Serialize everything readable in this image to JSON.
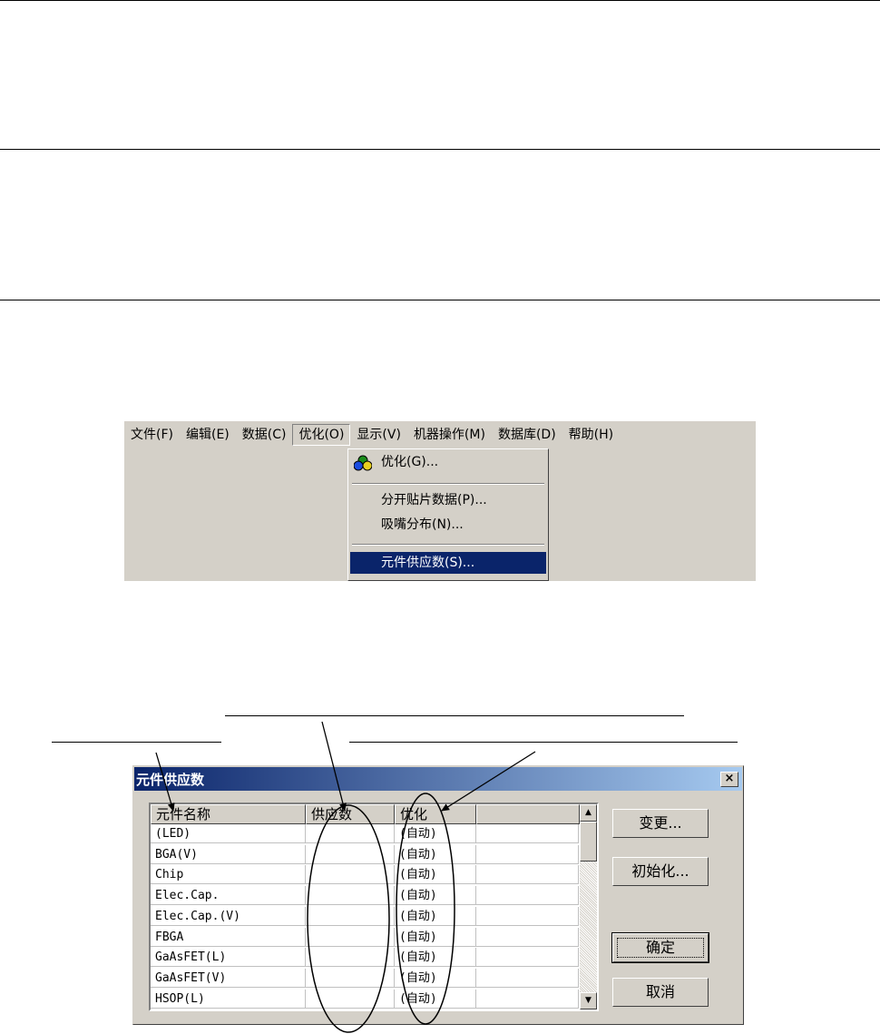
{
  "menu": {
    "items": [
      {
        "label": "文件(F)"
      },
      {
        "label": "编辑(E)"
      },
      {
        "label": "数据(C)"
      },
      {
        "label": "优化(O)",
        "open": true
      },
      {
        "label": "显示(V)"
      },
      {
        "label": "机器操作(M)"
      },
      {
        "label": "数据库(D)"
      },
      {
        "label": "帮助(H)"
      }
    ],
    "dropdown": [
      {
        "label": "优化(G)...",
        "icon": "optimize-icon"
      },
      {
        "label": "分开贴片数据(P)..."
      },
      {
        "label": "吸嘴分布(N)..."
      },
      {
        "label": "元件供应数(S)...",
        "highlighted": true
      }
    ]
  },
  "dialog": {
    "title": "元件供应数",
    "close_glyph": "×",
    "columns": [
      "元件名称",
      "供应数",
      "优化",
      ""
    ],
    "rows": [
      {
        "name": "(LED)",
        "supply": "",
        "optimize": "(自动)"
      },
      {
        "name": "BGA(V)",
        "supply": "",
        "optimize": "(自动)"
      },
      {
        "name": "Chip",
        "supply": "",
        "optimize": "(自动)"
      },
      {
        "name": "Elec.Cap.",
        "supply": "",
        "optimize": "(自动)"
      },
      {
        "name": "Elec.Cap.(V)",
        "supply": "",
        "optimize": "(自动)"
      },
      {
        "name": "FBGA",
        "supply": "",
        "optimize": "(自动)"
      },
      {
        "name": "GaAsFET(L)",
        "supply": "",
        "optimize": "(自动)"
      },
      {
        "name": "GaAsFET(V)",
        "supply": "",
        "optimize": "(自动)"
      },
      {
        "name": "HSOP(L)",
        "supply": "",
        "optimize": "(自动)"
      }
    ],
    "buttons": {
      "change": "变更...",
      "init": "初始化...",
      "ok": "确定",
      "cancel": "取消"
    },
    "scroll_up_glyph": "▲",
    "scroll_down_glyph": "▼"
  },
  "colors": {
    "highlight": "#0a246a",
    "face": "#d4d0c8"
  }
}
